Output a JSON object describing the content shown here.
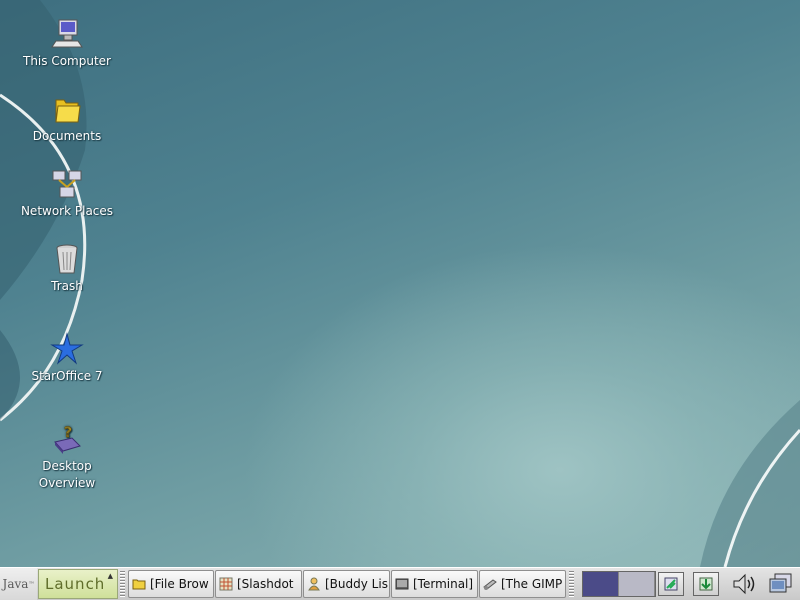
{
  "desktop": {
    "icons": [
      {
        "label": "This Computer",
        "icon": "computer-icon"
      },
      {
        "label": "Documents",
        "icon": "folder-icon"
      },
      {
        "label": "Network Places",
        "icon": "network-icon"
      },
      {
        "label": "Trash",
        "icon": "trash-icon"
      },
      {
        "label": "StarOffice 7",
        "icon": "staroffice-icon"
      },
      {
        "label": "Desktop\nOverview",
        "line1": "Desktop",
        "line2": "Overview",
        "icon": "desktop-overview-icon"
      }
    ]
  },
  "panel": {
    "java_label": "Java",
    "java_tm": "™",
    "launch_label": "Launch",
    "launch_arrow": "▲",
    "tasks": [
      {
        "label": "[File Brow",
        "icon": "folder-icon"
      },
      {
        "label": "[Slashdot",
        "icon": "browser-icon"
      },
      {
        "label": "[Buddy Lis",
        "icon": "buddy-icon"
      },
      {
        "label": "[Terminal]",
        "icon": "terminal-icon"
      },
      {
        "label": "[The GIMP",
        "icon": "gimp-icon"
      }
    ],
    "workspaces": {
      "count": 2,
      "active": 1
    },
    "tray": [
      "network-monitor-icon",
      "update-icon",
      "volume-icon",
      "show-desktop-icon"
    ]
  },
  "colors": {
    "desktop_dark": "#3e6f80",
    "desktop_light": "#9ec3c3",
    "panel_bg": "#d4d4d4",
    "launch_bg": "#d8e6a8",
    "pager_active": "#4b4b88"
  }
}
